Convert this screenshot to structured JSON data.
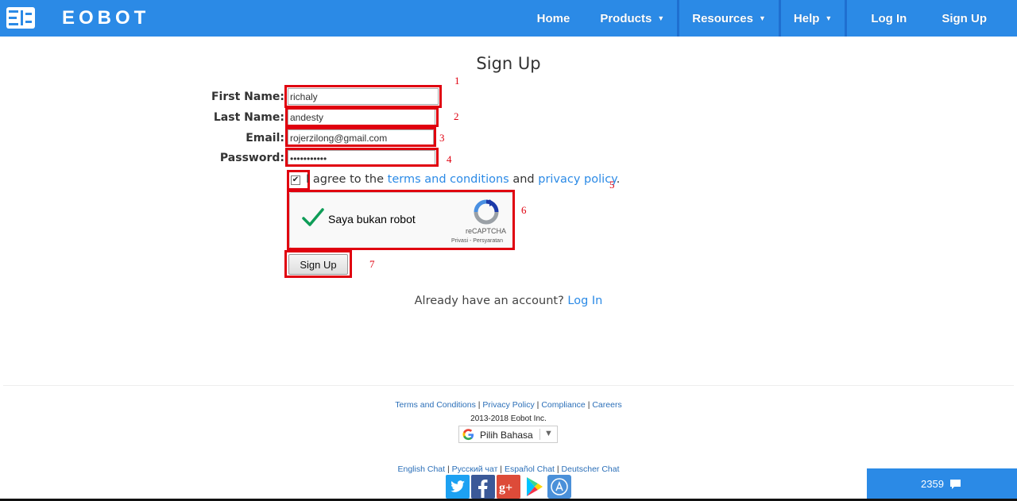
{
  "header": {
    "brand": "EOBOT",
    "nav": [
      {
        "label": "Home"
      },
      {
        "label": "Products",
        "caret": "▼"
      },
      {
        "label": "Resources",
        "caret": "▼"
      },
      {
        "label": "Help",
        "caret": "▼"
      },
      {
        "label": "Log In"
      },
      {
        "label": "Sign Up"
      }
    ],
    "bar_color": "#2b8ae6"
  },
  "form": {
    "title": "Sign Up",
    "first_name_label": "First Name:",
    "first_name_value": "richaly",
    "last_name_label": "Last Name:",
    "last_name_value": "andesty",
    "email_label": "Email:",
    "email_value": "rojerzilong@gmail.com",
    "password_label": "Password:",
    "password_value": "•••••••••••",
    "agree_checked": true,
    "agree_prefix": "I agree to the",
    "terms_link": "terms and conditions",
    "agree_mid": "and",
    "privacy_link": "privacy policy",
    "agree_suffix": ".",
    "submit_label": "Sign Up"
  },
  "captcha": {
    "text": "Saya bukan robot",
    "brand": "reCAPTCHA",
    "links": "Privasi - Persyaratan",
    "checked": true
  },
  "annotations": [
    "1",
    "2",
    "3",
    "4",
    "5",
    "6",
    "7"
  ],
  "already": {
    "text": "Already have an account?",
    "link": "Log In"
  },
  "footer": {
    "links": [
      "Terms and Conditions",
      "Privacy Policy",
      "Compliance",
      "Careers"
    ],
    "copyright": "2013-2018 Eobot Inc.",
    "language_label": "Pilih Bahasa",
    "language_arrow": "▼",
    "chat_links": [
      "English Chat",
      "Русский чат",
      "Español Chat",
      "Deutscher Chat"
    ],
    "social_icons": [
      "twitter-icon",
      "facebook-icon",
      "google-plus-icon",
      "google-play-icon",
      "app-store-icon"
    ]
  },
  "chat_widget": {
    "count": "2359"
  }
}
